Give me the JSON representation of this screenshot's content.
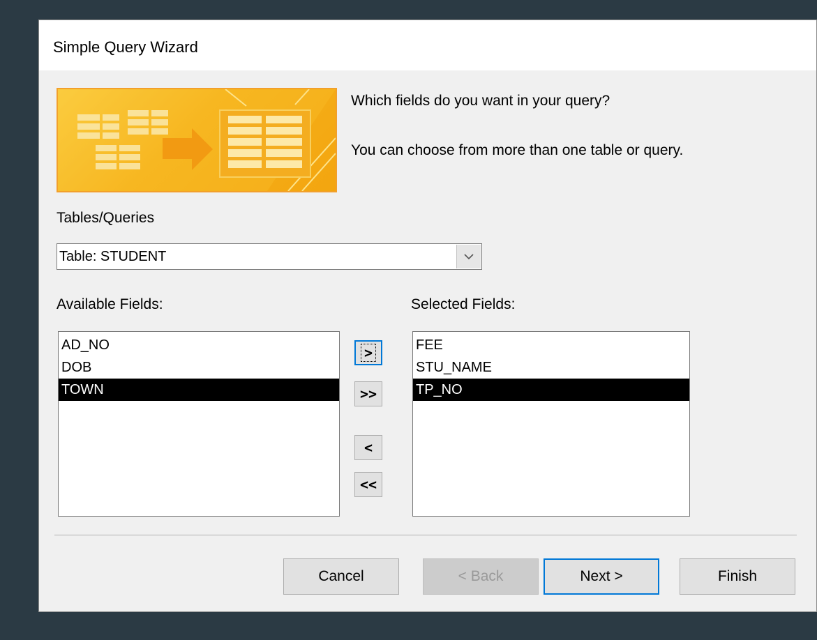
{
  "dialog": {
    "title": "Simple Query Wizard",
    "prompt_1": "Which fields do you want in your query?",
    "prompt_2": "You can choose from more than one table or query."
  },
  "tables_queries": {
    "label": "Tables/Queries",
    "value": "Table: STUDENT",
    "dropdown_icon": "chevron-down-icon"
  },
  "available_fields": {
    "label": "Available Fields:",
    "items": [
      "AD_NO",
      "DOB",
      "TOWN"
    ],
    "selected": "TOWN"
  },
  "selected_fields": {
    "label": "Selected Fields:",
    "items": [
      "FEE",
      "STU_NAME",
      "TP_NO"
    ],
    "selected": "TP_NO"
  },
  "move_buttons": {
    "add_one": ">",
    "add_all": ">>",
    "remove_one": "<",
    "remove_all": "<<"
  },
  "footer": {
    "cancel": "Cancel",
    "back": "< Back",
    "next": "Next >",
    "finish": "Finish"
  },
  "colors": {
    "accent_focus": "#0078d7",
    "banner_border": "#f2a02a",
    "banner_fill": "#f6b21c",
    "selection": "#000000"
  }
}
